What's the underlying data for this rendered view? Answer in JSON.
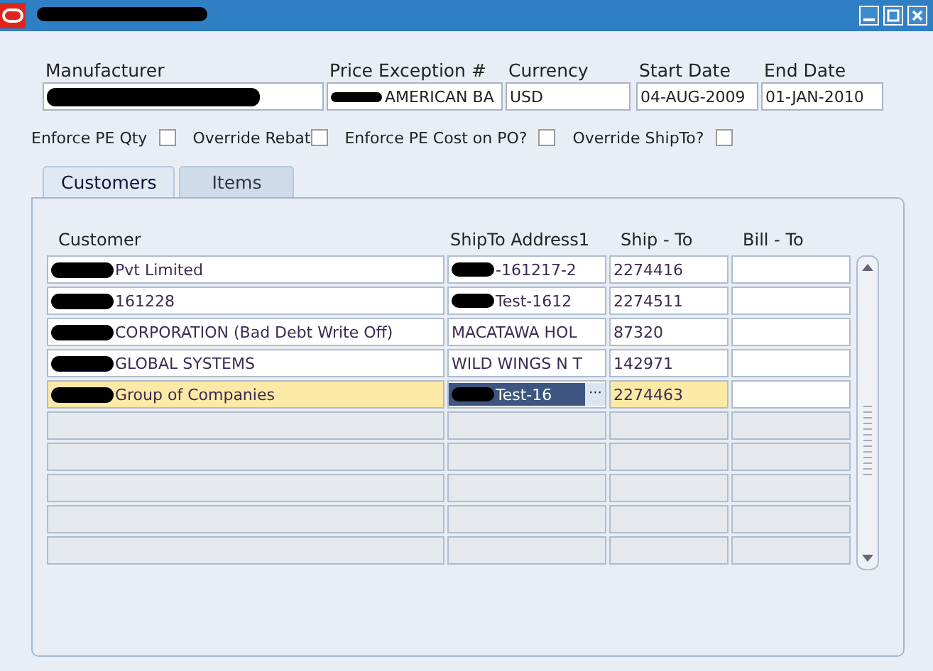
{
  "window": {
    "title_redacted": true
  },
  "header": {
    "fields": [
      {
        "label": "Manufacturer",
        "redacted": true
      },
      {
        "label": "Price Exception #",
        "value": "AMERICAN BA",
        "redacted": true
      },
      {
        "label": "Currency",
        "value": "USD",
        "redacted": false
      },
      {
        "label": "Start Date",
        "value": "04-AUG-2009",
        "redacted": false
      },
      {
        "label": "End Date",
        "value": "01-JAN-2010",
        "redacted": false
      }
    ]
  },
  "options": [
    {
      "label": "Enforce PE Qty",
      "checked": false
    },
    {
      "label": "Override Rebat",
      "checked": false
    },
    {
      "label": "Enforce PE Cost on PO?",
      "checked": false
    },
    {
      "label": "Override ShipTo?",
      "checked": false
    }
  ],
  "tabs": [
    {
      "label": "Customers",
      "selected": true
    },
    {
      "label": "Items",
      "selected": false
    }
  ],
  "table": {
    "columns": [
      "Customer",
      "ShipTo Address1",
      "Ship - To",
      "Bill - To"
    ],
    "rows": [
      {
        "selected": false,
        "cells": [
          {
            "text": "Pvt Limited",
            "redacted": true
          },
          {
            "text": "-161217-2",
            "redacted": true
          },
          {
            "text": "2274416"
          },
          {}
        ]
      },
      {
        "selected": false,
        "cells": [
          {
            "text": "161228",
            "redacted": true
          },
          {
            "text": "Test-1612",
            "redacted": true
          },
          {
            "text": "2274511"
          },
          {}
        ]
      },
      {
        "selected": false,
        "cells": [
          {
            "text": "CORPORATION (Bad Debt Write Off)",
            "redacted": true
          },
          {
            "text": "MACATAWA HOL"
          },
          {
            "text": "87320"
          },
          {}
        ]
      },
      {
        "selected": false,
        "cells": [
          {
            "text": "GLOBAL SYSTEMS",
            "redacted": true
          },
          {
            "text": "WILD WINGS N T"
          },
          {
            "text": "142971"
          },
          {}
        ]
      },
      {
        "selected": true,
        "cells": [
          {
            "text": "Group of Companies",
            "redacted": true
          },
          {
            "text": "Test-16",
            "redacted": true,
            "lov": "···"
          },
          {
            "text": "2274463"
          },
          {}
        ]
      }
    ]
  }
}
